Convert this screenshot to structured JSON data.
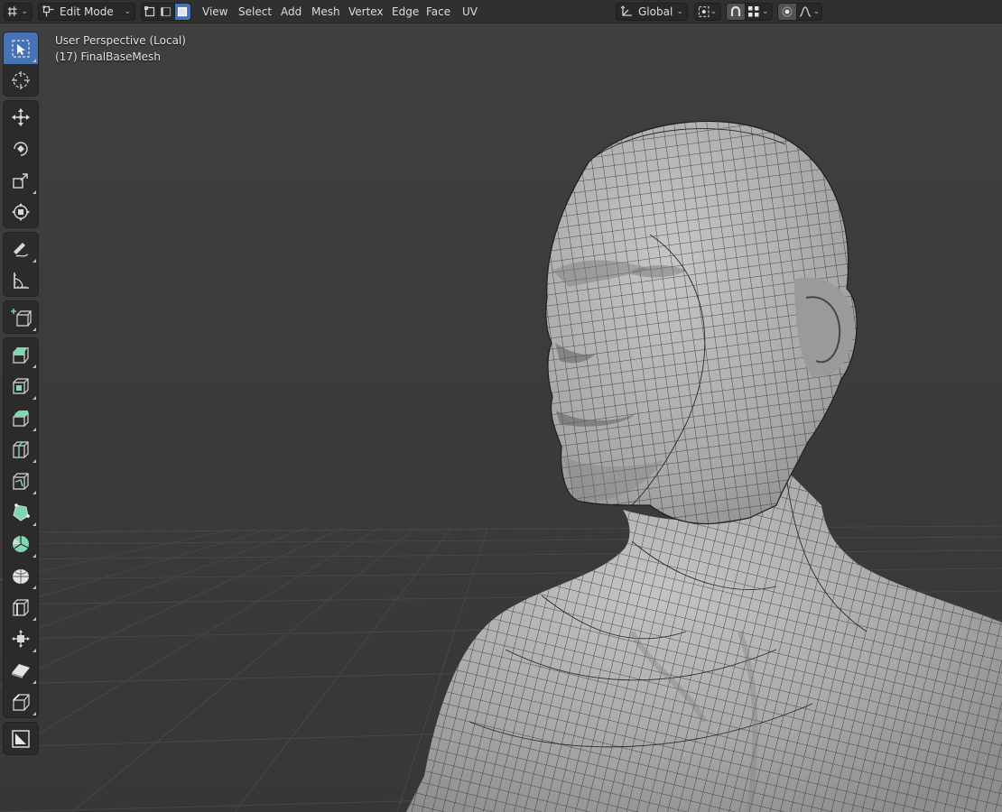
{
  "header": {
    "editor_type_icon": "viewport-editor-icon",
    "mode_dropdown": {
      "label": "Edit Mode",
      "icon": "mesh-edit-icon"
    },
    "select_modes": [
      {
        "name": "vertex-select-icon",
        "active": false
      },
      {
        "name": "edge-select-icon",
        "active": false
      },
      {
        "name": "face-select-icon",
        "active": true
      }
    ],
    "menu": [
      "View",
      "Select",
      "Add",
      "Mesh",
      "Vertex",
      "Edge",
      "Face",
      "UV"
    ],
    "transform_orientation": {
      "label": "Global",
      "icon": "axis-gizmo-icon"
    },
    "pivot_icon": "pivot-point-icon",
    "snap": {
      "toggle_icon": "magnet-icon",
      "target_icon": "increment-grid-icon"
    },
    "proportional": {
      "toggle_icon": "proportional-edit-icon",
      "falloff_icon": "falloff-curve-icon"
    }
  },
  "viewport": {
    "view_name": "User Perspective (Local)",
    "object_label": "(17) FinalBaseMesh",
    "background_color": "#3d3d3d",
    "mesh_color": "#a6a6a6",
    "wire_color": "#1e1e1e"
  },
  "toolbar": {
    "accent_color": "#4772b3",
    "groups": [
      [
        "select-box-icon",
        "cursor-icon"
      ],
      [
        "move-icon",
        "rotate-icon",
        "scale-icon",
        "transform-icon"
      ],
      [
        "annotate-icon",
        "measure-icon"
      ],
      [
        "add-cube-icon"
      ],
      [
        "extrude-region-icon",
        "inset-faces-icon",
        "bevel-icon",
        "loop-cut-icon",
        "knife-icon",
        "poly-build-icon",
        "spin-icon",
        "smooth-icon",
        "edge-slide-icon",
        "shrink-fatten-icon",
        "shear-icon",
        "rip-region-icon"
      ],
      [
        "tool-settings-icon"
      ]
    ]
  }
}
